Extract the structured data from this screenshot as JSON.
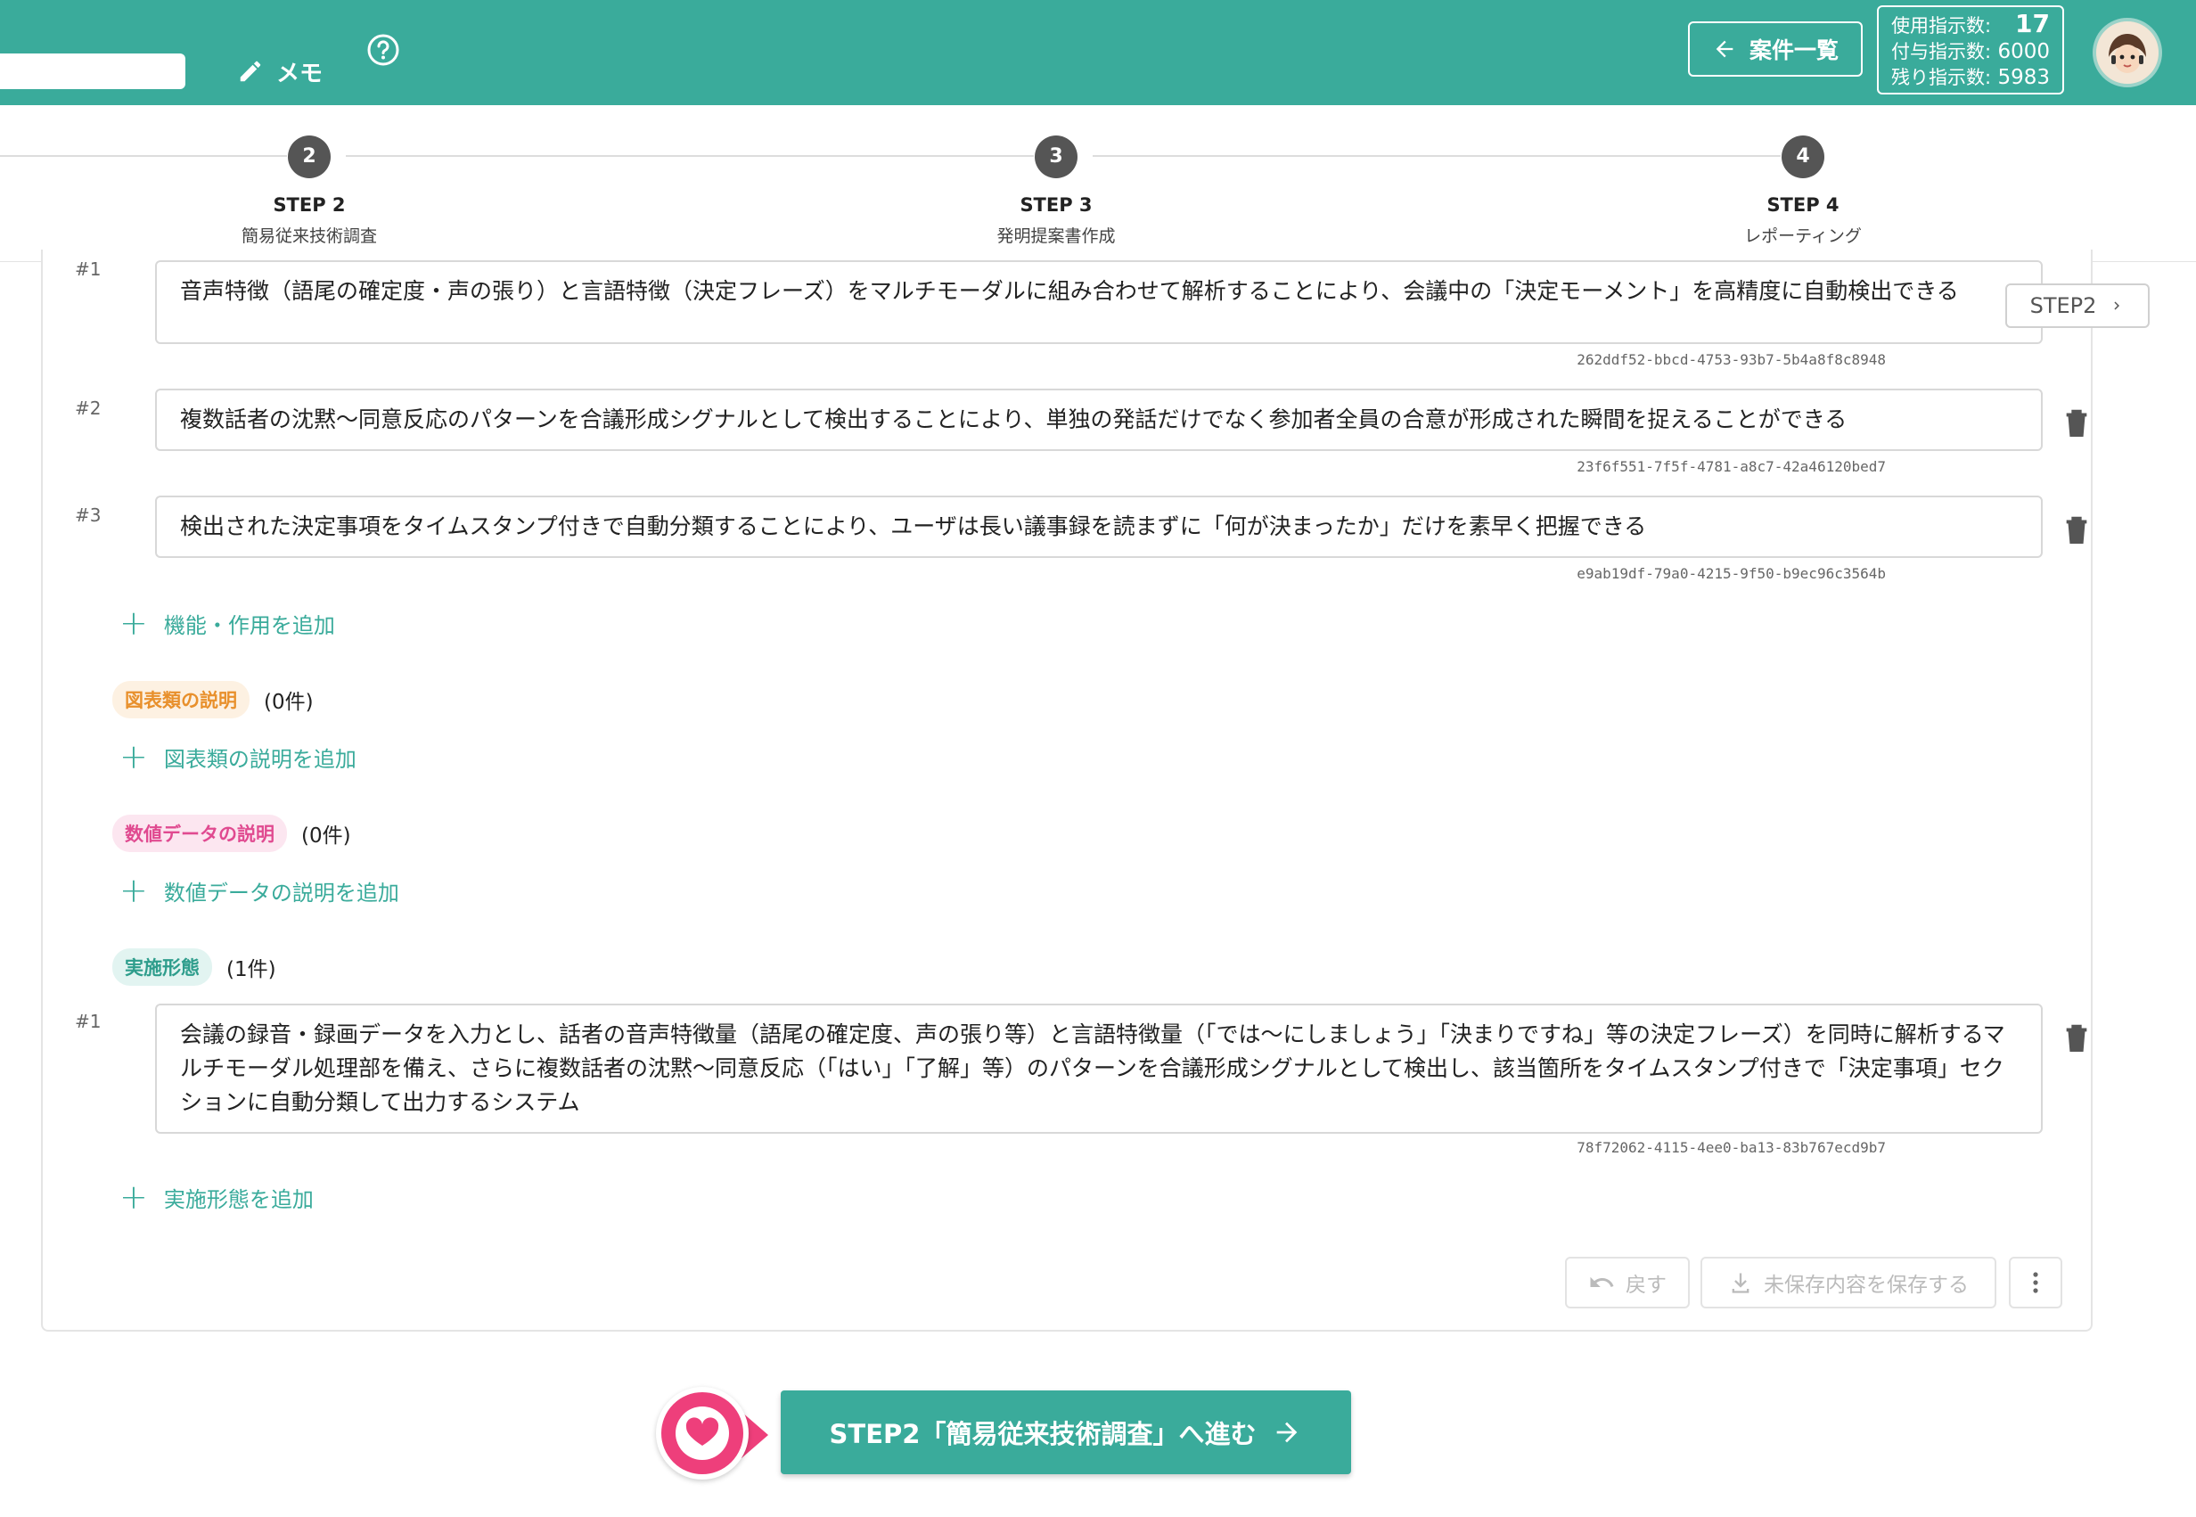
{
  "header": {
    "memo_label": "メモ",
    "back_label": "案件一覧",
    "usage": {
      "used_label": "使用指示数:",
      "used_value": "17",
      "granted_label": "付与指示数:",
      "granted_value": "6000",
      "remaining_label": "残り指示数:",
      "remaining_value": "5983"
    }
  },
  "stepper": {
    "steps": [
      {
        "num": "2",
        "label": "STEP 2",
        "sub": "簡易従来技術調査"
      },
      {
        "num": "3",
        "label": "STEP 3",
        "sub": "発明提案書作成"
      },
      {
        "num": "4",
        "label": "STEP 4",
        "sub": "レポーティング"
      }
    ]
  },
  "side_step": "STEP2",
  "functions": {
    "items": [
      {
        "num": "#1",
        "text": "音声特徴（語尾の確定度・声の張り）と言語特徴（決定フレーズ）をマルチモーダルに組み合わせて解析することにより、会議中の「決定モーメント」を高精度に自動検出できる",
        "uuid": "262ddf52-bbcd-4753-93b7-5b4a8f8c8948"
      },
      {
        "num": "#2",
        "text": "複数話者の沈黙〜同意反応のパターンを合議形成シグナルとして検出することにより、単独の発話だけでなく参加者全員の合意が形成された瞬間を捉えることができる",
        "uuid": "23f6f551-7f5f-4781-a8c7-42a46120bed7"
      },
      {
        "num": "#3",
        "text": "検出された決定事項をタイムスタンプ付きで自動分類することにより、ユーザは長い議事録を読まずに「何が決まったか」だけを素早く把握できる",
        "uuid": "e9ab19df-79a0-4215-9f50-b9ec96c3564b"
      }
    ],
    "add_label": "機能・作用を追加"
  },
  "figures": {
    "tag": "図表類の説明",
    "count": "(0件)",
    "add_label": "図表類の説明を追加"
  },
  "numeric": {
    "tag": "数値データの説明",
    "count": "(0件)",
    "add_label": "数値データの説明を追加"
  },
  "embodiment": {
    "tag": "実施形態",
    "count": "(1件)",
    "items": [
      {
        "num": "#1",
        "text": "会議の録音・録画データを入力とし、話者の音声特徴量（語尾の確定度、声の張り等）と言語特徴量（「では〜にしましょう」「決まりですね」等の決定フレーズ）を同時に解析するマルチモーダル処理部を備え、さらに複数話者の沈黙〜同意反応（「はい」「了解」等）のパターンを合議形成シグナルとして検出し、該当箇所をタイムスタンプ付きで「決定事項」セクションに自動分類して出力するシステム",
        "uuid": "78f72062-4115-4ee0-ba13-83b767ecd9b7"
      }
    ],
    "add_label": "実施形態を追加"
  },
  "actions": {
    "undo_label": "戻す",
    "save_label": "未保存内容を保存する"
  },
  "next_button": "STEP2「簡易従来技術調査」へ進む",
  "colors": {
    "primary": "#3aab9b",
    "heart": "#ee3f7b",
    "orange": "#e8902c",
    "pink": "#e04a90"
  }
}
